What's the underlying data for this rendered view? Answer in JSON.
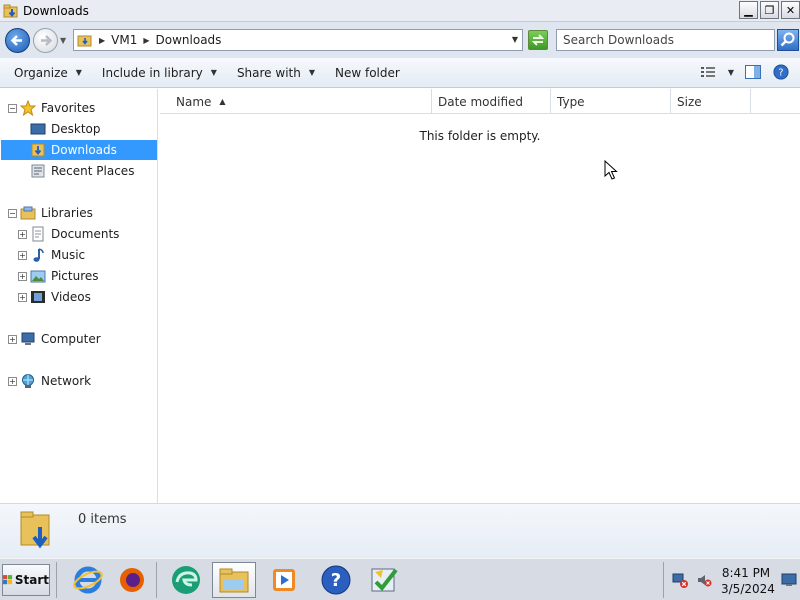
{
  "window": {
    "title": "Downloads",
    "buttons": {
      "minimize": "▁",
      "maximize": "❐",
      "close": "✕"
    }
  },
  "address": {
    "segments": [
      "VM1",
      "Downloads"
    ],
    "search_placeholder": "Search Downloads"
  },
  "toolbar": {
    "organize": "Organize",
    "include_library": "Include in library",
    "share_with": "Share with",
    "new_folder": "New folder"
  },
  "nav": {
    "favorites": "Favorites",
    "desktop": "Desktop",
    "downloads": "Downloads",
    "recent_places": "Recent Places",
    "libraries": "Libraries",
    "documents": "Documents",
    "music": "Music",
    "pictures": "Pictures",
    "videos": "Videos",
    "computer": "Computer",
    "network": "Network"
  },
  "columns": {
    "name": "Name",
    "date_modified": "Date modified",
    "type": "Type",
    "size": "Size"
  },
  "content": {
    "empty_message": "This folder is empty."
  },
  "details": {
    "item_count": "0 items"
  },
  "taskbar": {
    "start": "Start",
    "clock_time": "8:41 PM",
    "clock_date": "3/5/2024"
  },
  "colors": {
    "selection": "#3399ff",
    "taskbar": "#d6dbe4"
  }
}
